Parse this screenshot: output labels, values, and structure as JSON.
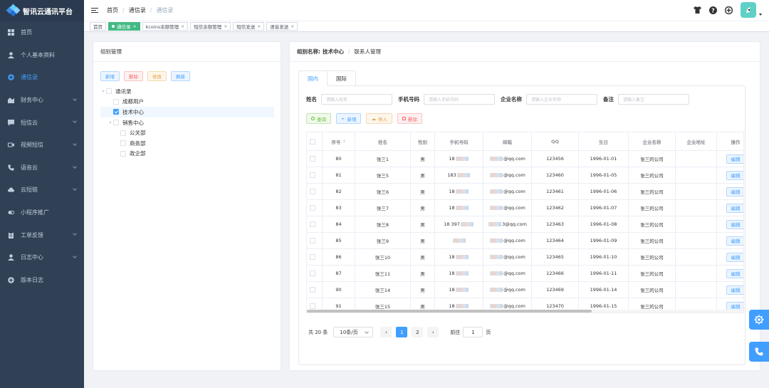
{
  "app": {
    "title": "智讯云通讯平台"
  },
  "sidebar": {
    "items": [
      {
        "label": "首页",
        "icon": "dashboard-icon",
        "active": false,
        "has_children": false
      },
      {
        "label": "个人基本资料",
        "icon": "user-icon",
        "active": false,
        "has_children": false
      },
      {
        "label": "通信录",
        "icon": "contacts-icon",
        "active": true,
        "has_children": false
      },
      {
        "label": "财务中心",
        "icon": "finance-icon",
        "active": false,
        "has_children": true
      },
      {
        "label": "短信云",
        "icon": "message-icon",
        "active": false,
        "has_children": true
      },
      {
        "label": "视频短信",
        "icon": "video-icon",
        "active": false,
        "has_children": true
      },
      {
        "label": "语音云",
        "icon": "phone-icon",
        "active": false,
        "has_children": true
      },
      {
        "label": "云短链",
        "icon": "cloud-icon",
        "active": false,
        "has_children": true
      },
      {
        "label": "小程序推广",
        "icon": "miniprogram-icon",
        "active": false,
        "has_children": false
      },
      {
        "label": "工单反馈",
        "icon": "clipboard-icon",
        "active": false,
        "has_children": true
      },
      {
        "label": "日志中心",
        "icon": "log-user-icon",
        "active": false,
        "has_children": true
      },
      {
        "label": "版本日志",
        "icon": "plus-circle-icon",
        "active": false,
        "has_children": false
      }
    ]
  },
  "breadcrumb": {
    "items": [
      "首页",
      "通信录",
      "通信录"
    ]
  },
  "tagsview": {
    "tags": [
      {
        "label": "首页",
        "active": false,
        "closable": false
      },
      {
        "label": "通信录",
        "active": true,
        "closable": true
      },
      {
        "label": "kcoins余额管理",
        "active": false,
        "closable": true
      },
      {
        "label": "短信余额管理",
        "active": false,
        "closable": true
      },
      {
        "label": "短信发送",
        "active": false,
        "closable": true
      },
      {
        "label": "语音发送",
        "active": false,
        "closable": true
      }
    ],
    "close_glyph": "×"
  },
  "group_panel": {
    "title": "组别管理",
    "buttons": {
      "add": "新增",
      "delete": "删除",
      "edit": "修改",
      "refresh": "刷新"
    },
    "tree": [
      {
        "label": "通讯录",
        "level": 0,
        "expanded": true,
        "checked": false,
        "highlight": false
      },
      {
        "label": "成都用户",
        "level": 1,
        "expanded": null,
        "checked": false,
        "highlight": false
      },
      {
        "label": "技术中心",
        "level": 1,
        "expanded": null,
        "checked": true,
        "highlight": true
      },
      {
        "label": "销售中心",
        "level": 1,
        "expanded": true,
        "checked": false,
        "highlight": false
      },
      {
        "label": "公关部",
        "level": 2,
        "expanded": null,
        "checked": false,
        "highlight": false
      },
      {
        "label": "商务部",
        "level": 2,
        "expanded": null,
        "checked": false,
        "highlight": false
      },
      {
        "label": "政企部",
        "level": 2,
        "expanded": null,
        "checked": false,
        "highlight": false
      }
    ]
  },
  "contacts_panel": {
    "header_label": "组别名称:",
    "group_name": "技术中心",
    "header_sep": "/",
    "header_sub": "联系人管理",
    "tabs": [
      "国内",
      "国际"
    ],
    "search": {
      "name_label": "姓名",
      "name_placeholder": "请输入姓名",
      "phone_label": "手机号码",
      "phone_placeholder": "请输入手机号码",
      "company_label": "企业名称",
      "company_placeholder": "请输入企业名称",
      "remark_label": "备注",
      "remark_placeholder": "请输入备注"
    },
    "toolbar": {
      "search": "查询",
      "add": "新增",
      "import": "导入",
      "delete": "删除"
    },
    "columns": [
      "序号",
      "姓名",
      "性别",
      "手机号码",
      "邮箱",
      "QQ",
      "生日",
      "企业名称",
      "企业地址",
      "操作"
    ],
    "rows": [
      {
        "id": "80",
        "name": "张三1",
        "gender": "男",
        "phone": "18",
        "email": "@qq.com",
        "qq": "123456",
        "birthday": "1996-01-01",
        "company": "张三的公司",
        "address": "",
        "action": "编辑"
      },
      {
        "id": "81",
        "name": "张三5",
        "gender": "男",
        "phone": "183",
        "email": "@qq.com",
        "qq": "123460",
        "birthday": "1996-01-05",
        "company": "张三的公司",
        "address": "",
        "action": "编辑"
      },
      {
        "id": "82",
        "name": "张三6",
        "gender": "男",
        "phone": "18",
        "email": "@qq.com",
        "qq": "123461",
        "birthday": "1996-01-06",
        "company": "张三的公司",
        "address": "",
        "action": "编辑"
      },
      {
        "id": "83",
        "name": "张三7",
        "gender": "男",
        "phone": "18",
        "email": "@qq.com",
        "qq": "123462",
        "birthday": "1996-01-07",
        "company": "张三的公司",
        "address": "",
        "action": "编辑"
      },
      {
        "id": "84",
        "name": "张三8",
        "gender": "男",
        "phone": "18 397",
        "email": "3@qq.com",
        "qq": "123463",
        "birthday": "1996-01-08",
        "company": "张三的公司",
        "address": "",
        "action": "编辑"
      },
      {
        "id": "85",
        "name": "张三9",
        "gender": "男",
        "phone": "",
        "email": "@qq.com",
        "qq": "123464",
        "birthday": "1996-01-09",
        "company": "张三的公司",
        "address": "",
        "action": "编辑"
      },
      {
        "id": "86",
        "name": "张三10",
        "gender": "男",
        "phone": "18",
        "email": "@qq.com",
        "qq": "123465",
        "birthday": "1996-01-10",
        "company": "张三的公司",
        "address": "",
        "action": "编辑"
      },
      {
        "id": "87",
        "name": "张三11",
        "gender": "男",
        "phone": "18",
        "email": "@qq.com",
        "qq": "123466",
        "birthday": "1996-01-11",
        "company": "张三的公司",
        "address": "",
        "action": "编辑"
      },
      {
        "id": "90",
        "name": "张三14",
        "gender": "男",
        "phone": "18",
        "email": "@qq.com",
        "qq": "123469",
        "birthday": "1996-01-14",
        "company": "张三的公司",
        "address": "",
        "action": "编辑"
      },
      {
        "id": "91",
        "name": "张三15",
        "gender": "男",
        "phone": "18",
        "email": "@qq.com",
        "qq": "123470",
        "birthday": "1996-01-15",
        "company": "张三的公司",
        "address": "",
        "action": "编辑"
      }
    ],
    "pagination": {
      "total_text": "共 20 条",
      "page_size": "10条/页",
      "pages": [
        "1",
        "2"
      ],
      "current": "1",
      "goto_label": "前往",
      "goto_value": "1",
      "goto_suffix": "页",
      "prev_glyph": "‹",
      "next_glyph": "›"
    }
  },
  "colors": {
    "accent": "#409eff",
    "sidebar_bg": "#304156",
    "tag_active": "#42b983",
    "danger": "#f56c6c",
    "warning": "#e6a23c",
    "success": "#67c23a"
  }
}
